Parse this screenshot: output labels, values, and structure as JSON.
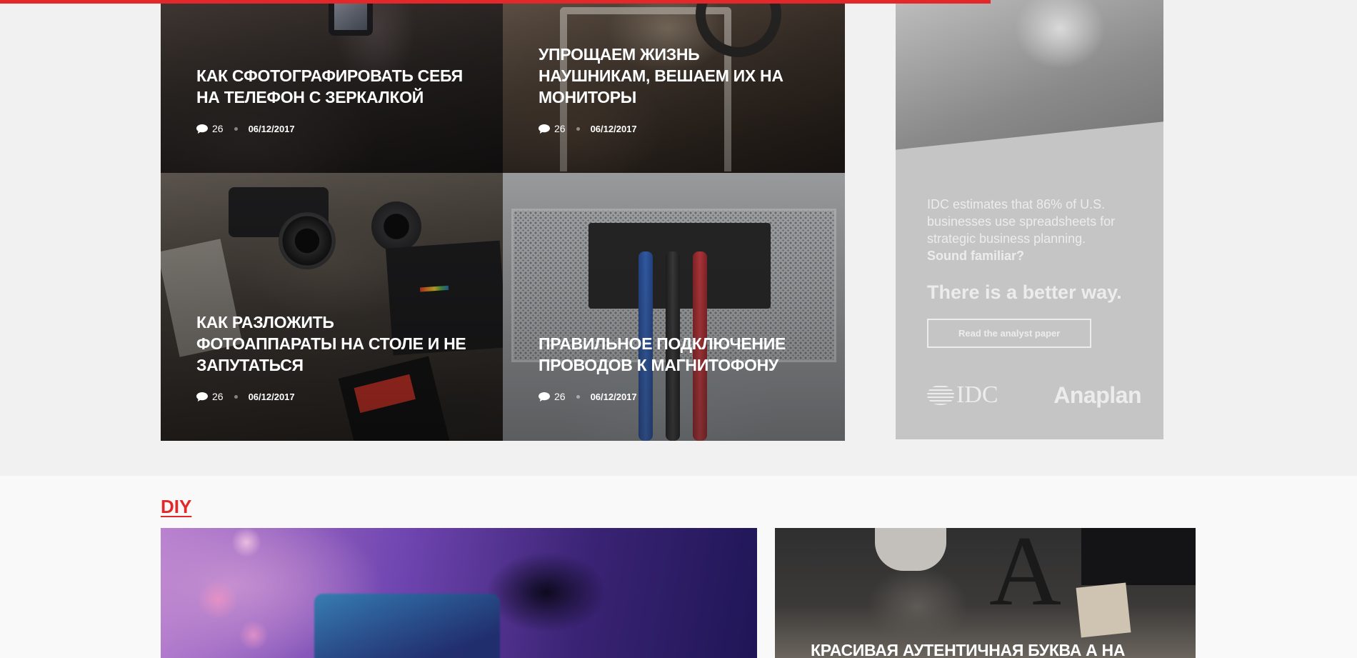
{
  "reading_progress": 0.73,
  "posts": [
    {
      "title": "КАК СФОТОГРАФИРОВАТЬ СЕБЯ НА ТЕЛЕФОН С ЗЕРКАЛКОЙ",
      "comments": "26",
      "date": "06/12/2017"
    },
    {
      "title": "УПРОЩАЕМ ЖИЗНЬ НАУШНИКАМ, ВЕШАЕМ ИХ НА МОНИТОРЫ",
      "comments": "26",
      "date": "06/12/2017"
    },
    {
      "title": "КАК РАЗЛОЖИТЬ ФОТОАППАРАТЫ НА СТОЛЕ И НЕ ЗАПУТАТЬСЯ",
      "comments": "26",
      "date": "06/12/2017"
    },
    {
      "title": "ПРАВИЛЬНОЕ ПОДКЛЮЧЕНИЕ ПРОВОДОВ К МАГНИТОФОНУ",
      "comments": "26",
      "date": "06/12/2017"
    }
  ],
  "ad": {
    "line1": "IDC estimates that 86% of U.S. businesses use spreadsheets for strategic business planning.",
    "line2": "Sound familiar?",
    "headline": "There is a better way.",
    "cta": "Read the analyst paper",
    "logo_left": "IDC",
    "logo_right": "Anaplan"
  },
  "diy": {
    "section_title": "DIY",
    "card2_title": "КРАСИВАЯ АУТЕНТИЧНАЯ БУКВА А НА"
  },
  "colors": {
    "accent": "#e3282c",
    "background": "#f1f1f1"
  }
}
